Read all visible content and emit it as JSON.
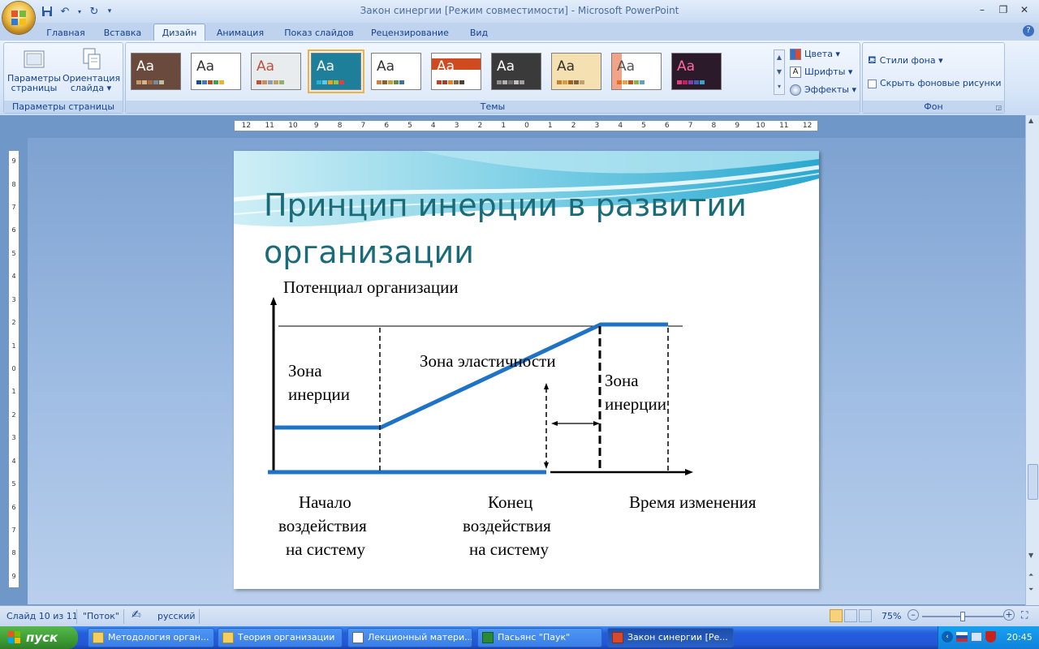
{
  "window": {
    "title": "Закон синергии [Режим совместимости] - Microsoft PowerPoint",
    "minimize_icon": "minimize-icon",
    "maximize_icon": "maximize-icon",
    "close_icon": "close-icon"
  },
  "qat": {
    "save": "save-icon",
    "undo": "undo-icon",
    "redo": "redo-icon",
    "customize": "▾"
  },
  "tabs": [
    {
      "label": "Главная"
    },
    {
      "label": "Вставка"
    },
    {
      "label": "Дизайн",
      "active": true
    },
    {
      "label": "Анимация"
    },
    {
      "label": "Показ слайдов"
    },
    {
      "label": "Рецензирование"
    },
    {
      "label": "Вид"
    }
  ],
  "ribbon": {
    "page_setup": {
      "params_line1": "Параметры",
      "params_line2": "страницы",
      "orient_line1": "Ориентация",
      "orient_line2": "слайда ▾",
      "label": "Параметры страницы"
    },
    "themes": {
      "label": "Темы",
      "items": [
        {
          "aa": "Aa",
          "bg": "#6b4a3e",
          "fg": "#ffffff",
          "sw": [
            "#c89a6a",
            "#d8b48a",
            "#a06a4a",
            "#7a8a9a",
            "#c0c0a0"
          ]
        },
        {
          "aa": "Aa",
          "bg": "#ffffff",
          "fg": "#333333",
          "sw": [
            "#1a4f8a",
            "#3a7ac0",
            "#c04a2a",
            "#40a050",
            "#f0b030"
          ]
        },
        {
          "aa": "Aa",
          "bg": "#e8ecef",
          "fg": "#c0503a",
          "sw": [
            "#c0503a",
            "#d08a5a",
            "#8aa0b0",
            "#c0a060",
            "#90b070"
          ]
        },
        {
          "aa": "Aa",
          "bg": "#1e7f9a",
          "fg": "#ffffff",
          "sw": [
            "#2ab0d0",
            "#60c8e0",
            "#f0a020",
            "#a0c040",
            "#e04040"
          ],
          "selected": true
        },
        {
          "aa": "Aa",
          "bg": "#ffffff",
          "fg": "#333333",
          "sw": [
            "#d08040",
            "#8a6030",
            "#c0a040",
            "#609040",
            "#4070a0"
          ]
        },
        {
          "aa": "Aa",
          "bg": "#ffffff",
          "fg": "#ffffff",
          "sw": [
            "#c0402a",
            "#a0402a",
            "#e08030",
            "#806040",
            "#504030"
          ],
          "band": "#d04a20"
        },
        {
          "aa": "Aa",
          "bg": "#3a3a3a",
          "fg": "#ffffff",
          "sw": [
            "#909090",
            "#b0b0b0",
            "#707070",
            "#c0c0c0",
            "#a0a0a0"
          ]
        },
        {
          "aa": "Aa",
          "bg": "#f4e0b0",
          "fg": "#333333",
          "sw": [
            "#c08030",
            "#d0a040",
            "#a06020",
            "#806040",
            "#c0a070"
          ]
        },
        {
          "aa": "Aa",
          "bg": "#ffffff",
          "fg": "#555555",
          "sw": [
            "#e07020",
            "#f0a040",
            "#c05020",
            "#90b040",
            "#60a0c0"
          ],
          "accent": "#f2a488"
        },
        {
          "aa": "Aa",
          "bg": "#2a1a2a",
          "fg": "#ff6aa0",
          "sw": [
            "#e04080",
            "#c02060",
            "#8040a0",
            "#4060c0",
            "#40a0c0"
          ]
        }
      ],
      "colors": "Цвета ▾",
      "fonts": "Шрифты ▾",
      "effects": "Эффекты ▾"
    },
    "background": {
      "styles": "Стили фона ▾",
      "hide": "Скрыть фоновые рисунки",
      "label": "Фон"
    }
  },
  "ruler": {
    "h_labels": [
      "12",
      "11",
      "10",
      "9",
      "8",
      "7",
      "6",
      "5",
      "4",
      "3",
      "2",
      "1",
      "0",
      "1",
      "2",
      "3",
      "4",
      "5",
      "6",
      "7",
      "8",
      "9",
      "10",
      "11",
      "12"
    ],
    "v_labels": [
      "9",
      "8",
      "7",
      "6",
      "5",
      "4",
      "3",
      "2",
      "1",
      "0",
      "1",
      "2",
      "3",
      "4",
      "5",
      "6",
      "7",
      "8",
      "9"
    ]
  },
  "slide": {
    "title": "Принцип инерции в развитии организации",
    "diagram": {
      "y_axis_label": "Потенциал организации",
      "zone_left_1": "Зона",
      "zone_left_2": "инерции",
      "zone_middle": "Зона эластичности",
      "zone_right_1": "Зона",
      "zone_right_2": "инерции",
      "start_1": "Начало",
      "start_2": "воздействия",
      "start_3": "на систему",
      "end_1": "Конец",
      "end_2": "воздействия",
      "end_3": "на систему",
      "time_label": "Время изменения",
      "line_color": "#1f73c6"
    }
  },
  "status": {
    "slide": "Слайд 10 из 11",
    "theme": "\"Поток\"",
    "lang": "русский",
    "zoom": "75%",
    "zoom_level": 0.5
  },
  "taskbar": {
    "start": "пуск",
    "tasks": [
      {
        "label": "Методология орган..."
      },
      {
        "label": "Теория организации"
      },
      {
        "label": "Лекционный матери..."
      },
      {
        "label": "Пасьянс \"Паук\""
      },
      {
        "label": "Закон синергии [Ре...",
        "active": true
      }
    ],
    "time": "20:45"
  }
}
